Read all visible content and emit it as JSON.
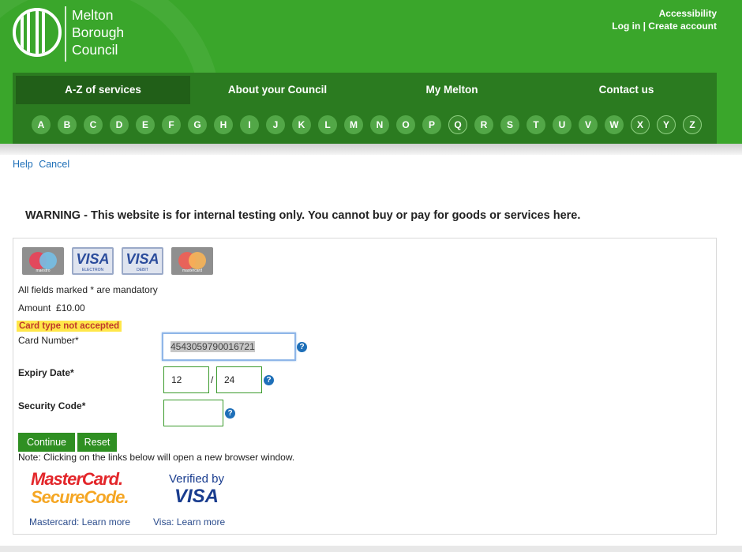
{
  "header": {
    "logo_lines": [
      "Melton",
      "Borough",
      "Council"
    ],
    "accessibility": "Accessibility",
    "login": "Log in | Create account"
  },
  "nav": {
    "items": [
      "A-Z of services",
      "About your Council",
      "My Melton",
      "Contact us"
    ],
    "active": "A-Z of services",
    "letters": [
      "A",
      "B",
      "C",
      "D",
      "E",
      "F",
      "G",
      "H",
      "I",
      "J",
      "K",
      "L",
      "M",
      "N",
      "O",
      "P",
      "Q",
      "R",
      "S",
      "T",
      "U",
      "V",
      "W",
      "X",
      "Y",
      "Z"
    ]
  },
  "links": {
    "help": "Help",
    "cancel": "Cancel"
  },
  "warning": "WARNING - This website is for internal testing only. You cannot buy or pay for goods or services here.",
  "cards": {
    "maestro": "maestro",
    "visa_electron": "VISA",
    "visa_electron_sub": "ELECTRON",
    "visa_debit": "VISA",
    "visa_debit_sub": "DEBIT",
    "mastercard": "mastercard"
  },
  "form": {
    "mandatory_note": "All fields marked * are mandatory",
    "amount_label": "Amount",
    "amount_value": "£10.00",
    "error": "Card type not accepted",
    "card_number_label": "Card Number*",
    "card_number_value": "4543059790016721",
    "expiry_label": "Expiry Date*",
    "expiry_month": "12",
    "expiry_separator": "/",
    "expiry_year": "24",
    "security_label": "Security Code*",
    "security_value": "",
    "help_glyph": "?",
    "continue": "Continue",
    "reset": "Reset",
    "note": "Note: Clicking on the links below will open a new browser window."
  },
  "secure": {
    "mc_line1": "MasterCard.",
    "mc_line2": "SecureCode.",
    "visa_line1": "Verified by",
    "visa_line2": "VISA",
    "mc_link": "Mastercard: Learn more",
    "visa_link": "Visa: Learn more"
  },
  "colors": {
    "header_green": "#3aa62b",
    "nav_dark": "#2b7b20",
    "button_green": "#2f8f22",
    "error_highlight": "#ffe74a"
  }
}
